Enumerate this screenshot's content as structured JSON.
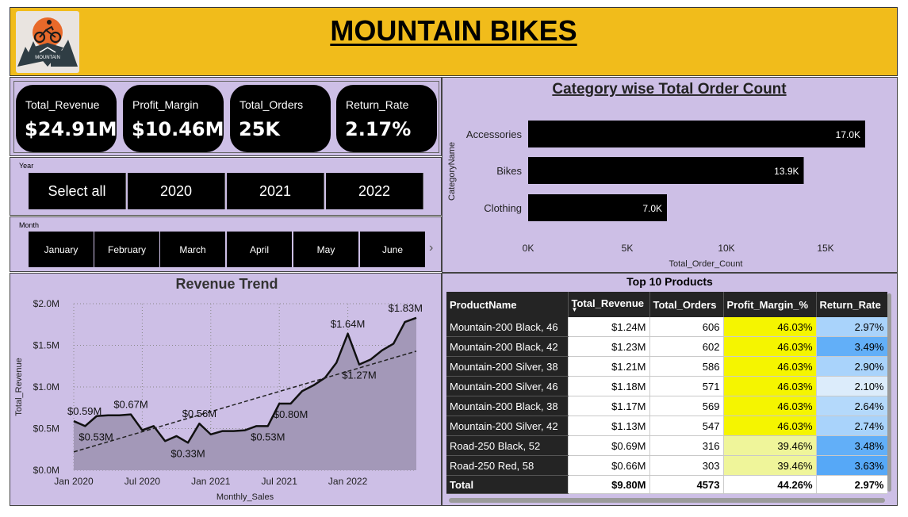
{
  "header": {
    "title": "MOUNTAIN BIKES ",
    "logo_text": "MOUNTAIN"
  },
  "kpis": [
    {
      "label": "Total_Revenue",
      "value": "$24.91M"
    },
    {
      "label": "Profit_Margin",
      "value": "$10.46M"
    },
    {
      "label": "Total_Orders",
      "value": "25K"
    },
    {
      "label": "Return_Rate",
      "value": "2.17%"
    }
  ],
  "year_slicer": {
    "label": "Year",
    "options": [
      "Select all",
      "2020",
      "2021",
      "2022"
    ]
  },
  "month_slicer": {
    "label": "Month",
    "options": [
      "January",
      "February",
      "March",
      "April",
      "May",
      "June"
    ]
  },
  "colors": {
    "panel_bg": "#cdbfe6",
    "header_bg": "#f1bc1b",
    "bar": "#000000",
    "area_fill": "#a398b8",
    "profit_high": "#f5f500",
    "profit_mid": "#eff59a"
  },
  "chart_data": [
    {
      "type": "bar",
      "orientation": "horizontal",
      "title": "Category wise Total Order Count",
      "xlabel": "Total_Order_Count",
      "ylabel": "CategoryName",
      "categories": [
        "Accessories",
        "Bikes",
        "Clothing"
      ],
      "values": [
        17000,
        13900,
        7000
      ],
      "data_labels": [
        "17.0K",
        "13.9K",
        "7.0K"
      ],
      "xlim": [
        0,
        17000
      ],
      "ticks": [
        0,
        5000,
        10000,
        15000
      ],
      "tick_labels": [
        "0K",
        "5K",
        "10K",
        "15K"
      ]
    },
    {
      "type": "area",
      "title": "Revenue Trend",
      "xlabel": "Monthly_Sales",
      "ylabel": "Total_Revenue",
      "ylim": [
        0,
        2.0
      ],
      "y_ticks": [
        0,
        0.5,
        1.0,
        1.5,
        2.0
      ],
      "y_tick_labels": [
        "$0.0M",
        "$0.5M",
        "$1.0M",
        "$1.5M",
        "$2.0M"
      ],
      "x_ticks": [
        0,
        6,
        12,
        18,
        24
      ],
      "x_tick_labels": [
        "Jan 2020",
        "Jul 2020",
        "Jan 2021",
        "Jul 2021",
        "Jan 2022"
      ],
      "values": [
        0.59,
        0.53,
        0.65,
        0.66,
        0.66,
        0.67,
        0.48,
        0.53,
        0.35,
        0.41,
        0.33,
        0.56,
        0.43,
        0.47,
        0.47,
        0.48,
        0.53,
        0.53,
        0.8,
        0.8,
        0.95,
        1.02,
        1.11,
        1.29,
        1.64,
        1.27,
        1.33,
        1.44,
        1.52,
        1.78,
        1.83
      ],
      "trend": [
        0.22,
        1.43
      ],
      "grid": true,
      "annotations": [
        {
          "index": 0,
          "text": "$0.59M",
          "pos": "above"
        },
        {
          "index": 1,
          "text": "$0.53M",
          "pos": "below"
        },
        {
          "index": 5,
          "text": "$0.67M",
          "pos": "above"
        },
        {
          "index": 10,
          "text": "$0.33M",
          "pos": "below"
        },
        {
          "index": 11,
          "text": "$0.56M",
          "pos": "above"
        },
        {
          "index": 17,
          "text": "$0.53M",
          "pos": "below"
        },
        {
          "index": 19,
          "text": "$0.80M",
          "pos": "below"
        },
        {
          "index": 24,
          "text": "$1.64M",
          "pos": "above"
        },
        {
          "index": 25,
          "text": "$1.27M",
          "pos": "below"
        },
        {
          "index": 30,
          "text": "$1.83M",
          "pos": "above"
        }
      ]
    },
    {
      "type": "table",
      "title": "Top 10 Products",
      "columns": [
        "ProductName",
        "Total_Revenue",
        "Total_Orders",
        "Profit_Margin_%",
        "Return_Rate"
      ],
      "rows": [
        [
          "Mountain-200 Black, 46",
          "$1.24M",
          "606",
          "46.03%",
          "2.97%"
        ],
        [
          "Mountain-200 Black, 42",
          "$1.23M",
          "602",
          "46.03%",
          "3.49%"
        ],
        [
          "Mountain-200 Silver, 38",
          "$1.21M",
          "586",
          "46.03%",
          "2.90%"
        ],
        [
          "Mountain-200 Silver, 46",
          "$1.18M",
          "571",
          "46.03%",
          "2.10%"
        ],
        [
          "Mountain-200 Black, 38",
          "$1.17M",
          "569",
          "46.03%",
          "2.64%"
        ],
        [
          "Mountain-200 Silver, 42",
          "$1.13M",
          "547",
          "46.03%",
          "2.74%"
        ],
        [
          "Road-250 Black, 52",
          "$0.69M",
          "316",
          "39.46%",
          "3.48%"
        ],
        [
          "Road-250 Red, 58",
          "$0.66M",
          "303",
          "39.46%",
          "3.63%"
        ]
      ],
      "total": [
        "Total",
        "$9.80M",
        "4573",
        "44.26%",
        "2.97%"
      ],
      "profit_colors": [
        "#f5f500",
        "#f5f500",
        "#f5f500",
        "#f5f500",
        "#f5f500",
        "#f5f500",
        "#eff59a",
        "#eff59a"
      ],
      "return_colors": [
        "#a9d3fb",
        "#62aff8",
        "#a9d3fb",
        "#dcecfb",
        "#b4d9fb",
        "#a9d3fb",
        "#62aff8",
        "#56a8f7"
      ]
    }
  ]
}
